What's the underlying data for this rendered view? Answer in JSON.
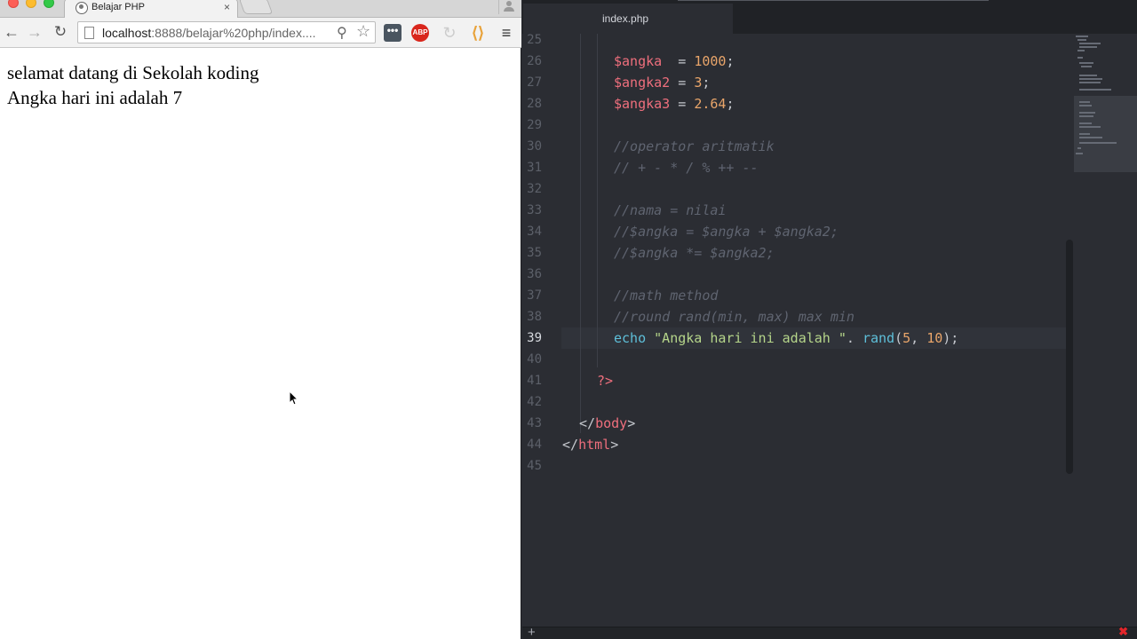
{
  "browser": {
    "tab_title": "Belajar PHP",
    "tab_close": "×",
    "url_host": "localhost",
    "url_rest": ":8888/belajar%20php/index....",
    "extensions": {
      "abp": "ABP",
      "dots": "•••"
    },
    "icons": {
      "back": "←",
      "forward": "→",
      "reload": "↻",
      "zoom": "⚲",
      "star": "☆",
      "spin": "↻",
      "bracket": "⟨⟩",
      "menu": "≡"
    },
    "page": {
      "line1": "selamat datang di Sekolah koding",
      "line2": "Angka hari ini adalah 7"
    }
  },
  "editor": {
    "tab_title": "index.php",
    "active_line": 39,
    "code": {
      "l26_var": "$angka",
      "l26_eq": "  = ",
      "l26_num": "1000",
      "l27_var": "$angka2",
      "l27_eq": " = ",
      "l27_num": "3",
      "l28_var": "$angka3",
      "l28_eq": " = ",
      "l28_num": "2.64",
      "semi": ";",
      "l30": "//operator aritmatik",
      "l31": "// + - * / % ++ --",
      "l33": "//nama = nilai",
      "l34": "//$angka = $angka + $angka2;",
      "l35": "//$angka *= $angka2;",
      "l37": "//math method",
      "l38": "//round rand(min, max) max min",
      "l39_echo": "echo",
      "l39_str": "\"Angka hari ini adalah \"",
      "l39_dot": ". ",
      "l39_fn": "rand",
      "l39_open": "(",
      "l39_a": "5",
      "l39_comma": ", ",
      "l39_b": "10",
      "l39_close": ");",
      "l41_tag": "?>",
      "l43_open": "</",
      "l43_tag": "body",
      "l43_close": ">",
      "l44_open": "</",
      "l44_tag": "html",
      "l44_close": ">"
    },
    "line_numbers": [
      "25",
      "26",
      "27",
      "28",
      "29",
      "30",
      "31",
      "32",
      "33",
      "34",
      "35",
      "36",
      "37",
      "38",
      "39",
      "40",
      "41",
      "42",
      "43",
      "44",
      "45"
    ],
    "status": {
      "plus": "+",
      "close": "✖"
    }
  }
}
